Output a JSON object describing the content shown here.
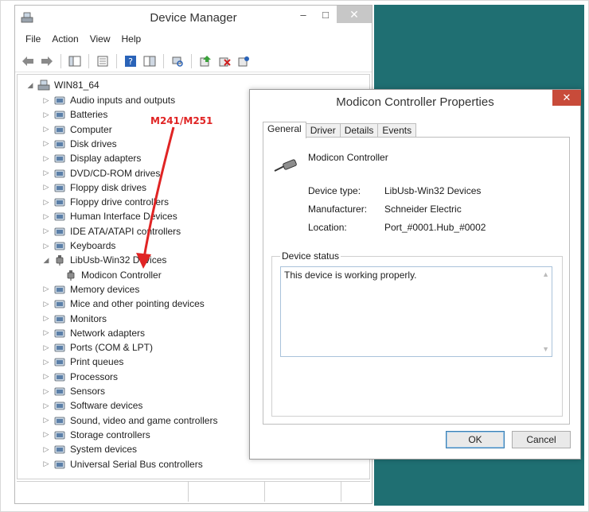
{
  "device_manager": {
    "title": "Device Manager",
    "menu": [
      "File",
      "Action",
      "View",
      "Help"
    ],
    "tree": {
      "root": "WIN81_64",
      "items": [
        {
          "label": "Audio inputs and outputs",
          "icon": "speaker-icon"
        },
        {
          "label": "Batteries",
          "icon": "battery-icon"
        },
        {
          "label": "Computer",
          "icon": "computer-icon"
        },
        {
          "label": "Disk drives",
          "icon": "disk-drive-icon"
        },
        {
          "label": "Display adapters",
          "icon": "display-adapter-icon"
        },
        {
          "label": "DVD/CD-ROM drives",
          "icon": "dvd-drive-icon"
        },
        {
          "label": "Floppy disk drives",
          "icon": "floppy-disk-icon"
        },
        {
          "label": "Floppy drive controllers",
          "icon": "floppy-controller-icon"
        },
        {
          "label": "Human Interface Devices",
          "icon": "hid-icon"
        },
        {
          "label": "IDE ATA/ATAPI controllers",
          "icon": "ide-controller-icon"
        },
        {
          "label": "Keyboards",
          "icon": "keyboard-icon"
        },
        {
          "label": "LibUsb-Win32 Devices",
          "icon": "usb-plug-icon",
          "expanded": true
        },
        {
          "label": "Modicon Controller",
          "icon": "usb-plug-icon",
          "child": true
        },
        {
          "label": "Memory devices",
          "icon": "memory-icon"
        },
        {
          "label": "Mice and other pointing devices",
          "icon": "mouse-icon"
        },
        {
          "label": "Monitors",
          "icon": "monitor-icon"
        },
        {
          "label": "Network adapters",
          "icon": "network-adapter-icon"
        },
        {
          "label": "Ports (COM & LPT)",
          "icon": "port-icon"
        },
        {
          "label": "Print queues",
          "icon": "printer-icon"
        },
        {
          "label": "Processors",
          "icon": "processor-icon"
        },
        {
          "label": "Sensors",
          "icon": "sensor-icon"
        },
        {
          "label": "Software devices",
          "icon": "software-device-icon"
        },
        {
          "label": "Sound, video and game controllers",
          "icon": "sound-icon"
        },
        {
          "label": "Storage controllers",
          "icon": "storage-controller-icon"
        },
        {
          "label": "System devices",
          "icon": "system-device-icon"
        },
        {
          "label": "Universal Serial Bus controllers",
          "icon": "usb-icon"
        }
      ]
    }
  },
  "annotation": {
    "text": "M241/M251",
    "color": "#e02424"
  },
  "properties_dialog": {
    "title": "Modicon Controller Properties",
    "tabs": [
      "General",
      "Driver",
      "Details",
      "Events"
    ],
    "active_tab": "General",
    "device_name": "Modicon Controller",
    "fields": [
      {
        "label": "Device type:",
        "value": "LibUsb-Win32 Devices"
      },
      {
        "label": "Manufacturer:",
        "value": "Schneider Electric"
      },
      {
        "label": "Location:",
        "value": "Port_#0001.Hub_#0002"
      }
    ],
    "status_group_label": "Device status",
    "status_text": "This device is working properly.",
    "ok_label": "OK",
    "cancel_label": "Cancel"
  },
  "colors": {
    "desktop": "#1f6f72",
    "close_button": "#c84b3a",
    "annotation": "#e02424"
  }
}
